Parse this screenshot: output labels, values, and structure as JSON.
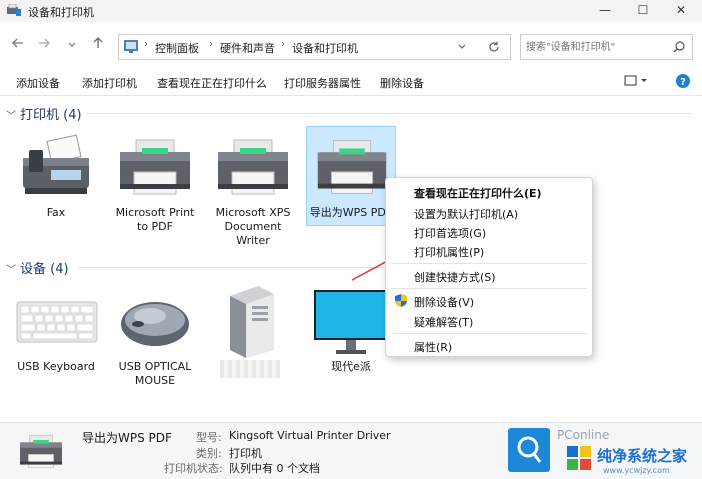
{
  "window": {
    "title": "设备和打印机",
    "controls": {
      "minimize": "—",
      "maximize": "☐",
      "close": "✕"
    }
  },
  "nav": {
    "back_icon": "arrow-left-icon",
    "forward_icon": "arrow-right-icon",
    "recent_icon": "chevron-down-icon",
    "up_icon": "arrow-up-icon"
  },
  "address": {
    "crumbs": [
      "控制面板",
      "硬件和声音",
      "设备和打印机"
    ],
    "refresh_icon": "refresh-icon"
  },
  "search": {
    "placeholder": "搜索\"设备和打印机\""
  },
  "commands": {
    "add_device": "添加设备",
    "add_printer": "添加打印机",
    "see_printing": "查看现在正在打印什么",
    "print_server": "打印服务器属性",
    "remove_device": "删除设备"
  },
  "groups": {
    "printers": {
      "label": "打印机 (4)"
    },
    "devices": {
      "label": "设备 (4)"
    }
  },
  "printers": [
    {
      "label": "Fax",
      "icon": "fax-icon"
    },
    {
      "label": "Microsoft Print to PDF",
      "icon": "printer-icon"
    },
    {
      "label": "Microsoft XPS Document Writer",
      "icon": "printer-icon"
    },
    {
      "label": "导出为WPS PDF",
      "icon": "printer-icon"
    }
  ],
  "devices": [
    {
      "label": "USB Keyboard",
      "icon": "keyboard-icon"
    },
    {
      "label": "USB OPTICAL MOUSE",
      "icon": "mouse-icon"
    },
    {
      "label": "",
      "icon": "computer-tower-icon"
    },
    {
      "label": "现代e派",
      "icon": "monitor-icon"
    }
  ],
  "context_menu": {
    "items": [
      "查看现在正在打印什么(E)",
      "设置为默认打印机(A)",
      "打印首选项(G)",
      "打印机属性(P)",
      "创建快捷方式(S)",
      "删除设备(V)",
      "疑难解答(T)",
      "属性(R)"
    ]
  },
  "details": {
    "name": "导出为WPS PDF",
    "model_key": "型号:",
    "model_val": "Kingsoft Virtual Printer Driver",
    "category_key": "类别:",
    "category_val": "打印机",
    "status_key": "打印机状态:",
    "status_val": "队列中有 0 个文档"
  },
  "watermark": {
    "brand": "PConline",
    "site_name": "纯净系统之家",
    "site_url": "www.ycwjzy.com"
  },
  "colors": {
    "selection": "#cce8ff",
    "group_header": "#1e3a6f",
    "arrow": "#d33a3a",
    "help": "#1e7fd6"
  }
}
